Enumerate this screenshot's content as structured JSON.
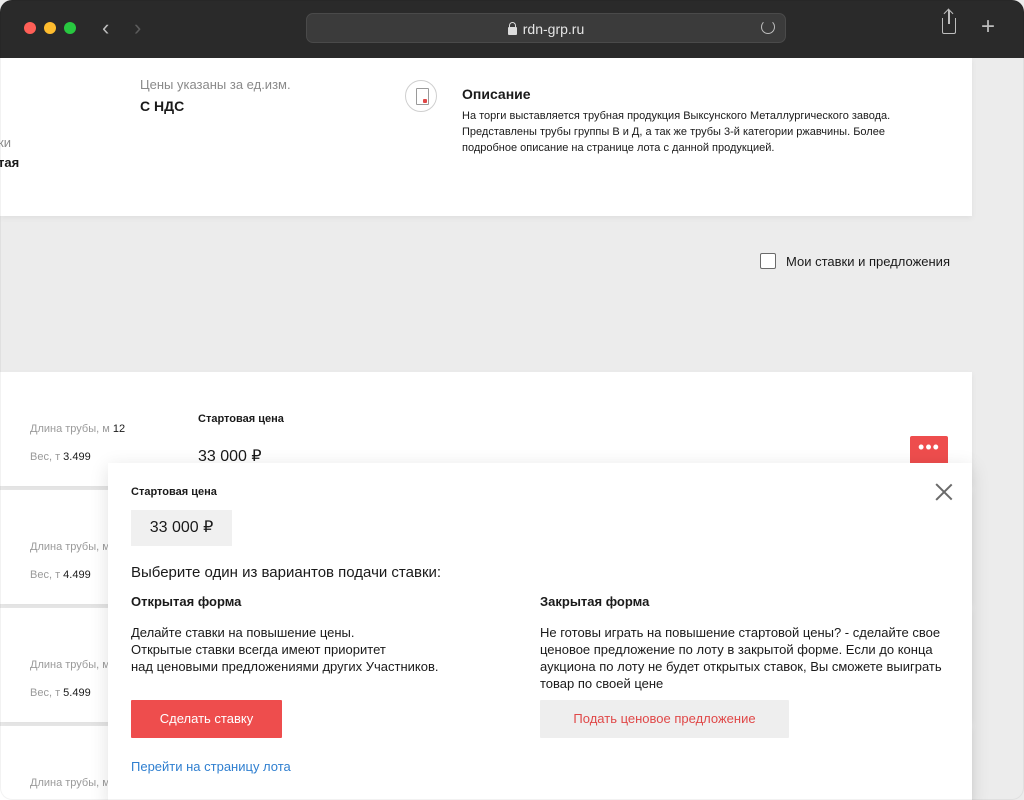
{
  "browser": {
    "url": "rdn-grp.ru",
    "back_glyph": "‹",
    "forward_glyph": "›",
    "new_tab_glyph": "+"
  },
  "top_card": {
    "price_label": "Цены указаны за ед.изм.",
    "price_value": "С НДС",
    "cut_label": "ки",
    "cut_value": "тая",
    "description_title": "Описание",
    "description_text": "На торги выставляется трубная продукция Выксунского Металлургического завода. Представлены трубы группы В и Д, а так же трубы 3-й категории ржавчины. Более подробное описание на странице лота с данной продукцией."
  },
  "filters": {
    "my_bets_label": "Мои ставки и предложения"
  },
  "lots": [
    {
      "length_label": "Длина трубы, м",
      "length_value": "12",
      "weight_label": "Вес, т",
      "weight_value": "3.499",
      "start_label": "Стартовая цена",
      "start_value": "33 000 ₽",
      "more_label": "•••"
    },
    {
      "length_label": "Длина трубы, м",
      "length_value": "",
      "weight_label": "Вес, т",
      "weight_value": "4.499"
    },
    {
      "length_label": "Длина трубы, м",
      "length_value": "",
      "weight_label": "Вес, т",
      "weight_value": "5.499"
    },
    {
      "length_label": "Длина трубы, м",
      "length_value": "",
      "weight_label": "",
      "weight_value": ""
    }
  ],
  "modal": {
    "start_label": "Стартовая цена",
    "start_value": "33 000 ₽",
    "prompt": "Выберите один из вариантов подачи ставки:",
    "open_title": "Открытая форма",
    "open_text": "Делайте ставки на повышение цены.\nОткрытые ставки всегда имеют приоритет\nнад ценовыми предложениями других Участников.",
    "closed_title": "Закрытая форма",
    "closed_text": "Не готовы играть на повышение стартовой цены? - сделайте свое ценовое предложение по лоту в закрытой форме. Если до конца аукциона по лоту не будет открытых ставок, Вы сможете выиграть товар по своей цене",
    "bid_button": "Сделать ставку",
    "offer_button": "Подать ценовое предложение",
    "lot_link": "Перейти на страницу лота"
  },
  "colors": {
    "accent": "#ee4d4d",
    "link": "#2f7fd0",
    "chrome": "#2a2a2a"
  }
}
